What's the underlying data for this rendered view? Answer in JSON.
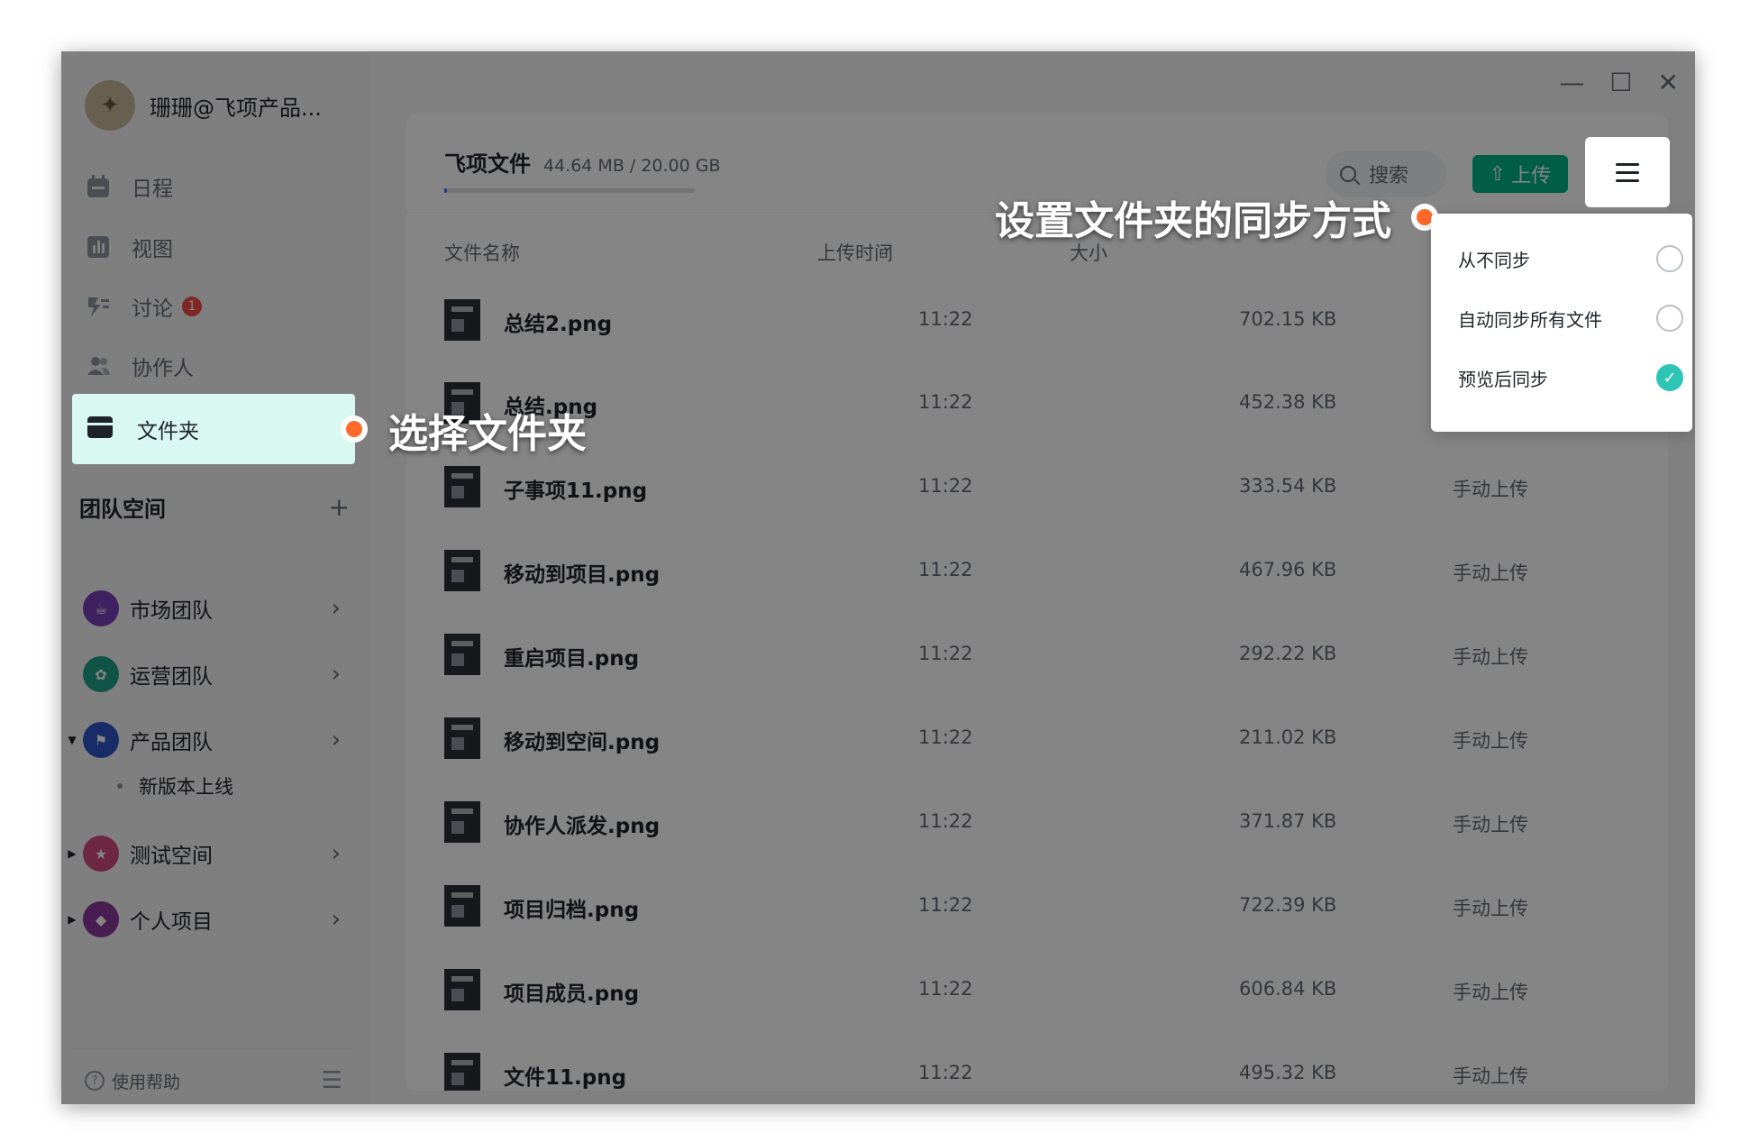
{
  "window": {
    "controls": {
      "minimize": "—",
      "maximize": "☐",
      "close": "✕"
    }
  },
  "sidebar": {
    "profile_name": "珊珊@飞项产品...",
    "nav": [
      {
        "label": "日程",
        "icon": "calendar-icon"
      },
      {
        "label": "视图",
        "icon": "chart-icon"
      },
      {
        "label": "讨论",
        "icon": "discussion-icon",
        "badge": "1"
      },
      {
        "label": "协作人",
        "icon": "people-icon"
      },
      {
        "label": "文件夹",
        "icon": "folder-icon"
      }
    ],
    "team_title": "团队空间",
    "team_add": "+",
    "teams": [
      {
        "label": "市场团队",
        "color": "#7a3fb8"
      },
      {
        "label": "运营团队",
        "color": "#1fa089"
      },
      {
        "label": "产品团队",
        "color": "#2f55c7"
      },
      {
        "label": "测试空间",
        "color": "#d14b7e"
      },
      {
        "label": "个人项目",
        "color": "#8a3a9e"
      }
    ],
    "sub_item": "新版本上线",
    "help": "使用帮助"
  },
  "main": {
    "title": "飞项文件",
    "quota": "44.64 MB / 20.00 GB",
    "search_label": "搜索",
    "upload_label": "上传",
    "columns": {
      "name": "文件名称",
      "time": "上传时间",
      "size": "大小"
    },
    "files": [
      {
        "name": "总结2.png",
        "time": "11:22",
        "size": "702.15 KB",
        "source": ""
      },
      {
        "name": "总结.png",
        "time": "11:22",
        "size": "452.38 KB",
        "source": ""
      },
      {
        "name": "子事项11.png",
        "time": "11:22",
        "size": "333.54 KB",
        "source": "手动上传"
      },
      {
        "name": "移动到项目.png",
        "time": "11:22",
        "size": "467.96 KB",
        "source": "手动上传"
      },
      {
        "name": "重启项目.png",
        "time": "11:22",
        "size": "292.22 KB",
        "source": "手动上传"
      },
      {
        "name": "移动到空间.png",
        "time": "11:22",
        "size": "211.02 KB",
        "source": "手动上传"
      },
      {
        "name": "协作人派发.png",
        "time": "11:22",
        "size": "371.87 KB",
        "source": "手动上传"
      },
      {
        "name": "项目归档.png",
        "time": "11:22",
        "size": "722.39 KB",
        "source": "手动上传"
      },
      {
        "name": "项目成员.png",
        "time": "11:22",
        "size": "606.84 KB",
        "source": "手动上传"
      },
      {
        "name": "文件11.png",
        "time": "11:22",
        "size": "495.32 KB",
        "source": "手动上传"
      }
    ]
  },
  "sync_menu": {
    "options": [
      {
        "label": "从不同步",
        "selected": false
      },
      {
        "label": "自动同步所有文件",
        "selected": false
      },
      {
        "label": "预览后同步",
        "selected": true
      }
    ]
  },
  "callouts": {
    "folder": "选择文件夹",
    "sync": "设置文件夹的同步方式"
  }
}
